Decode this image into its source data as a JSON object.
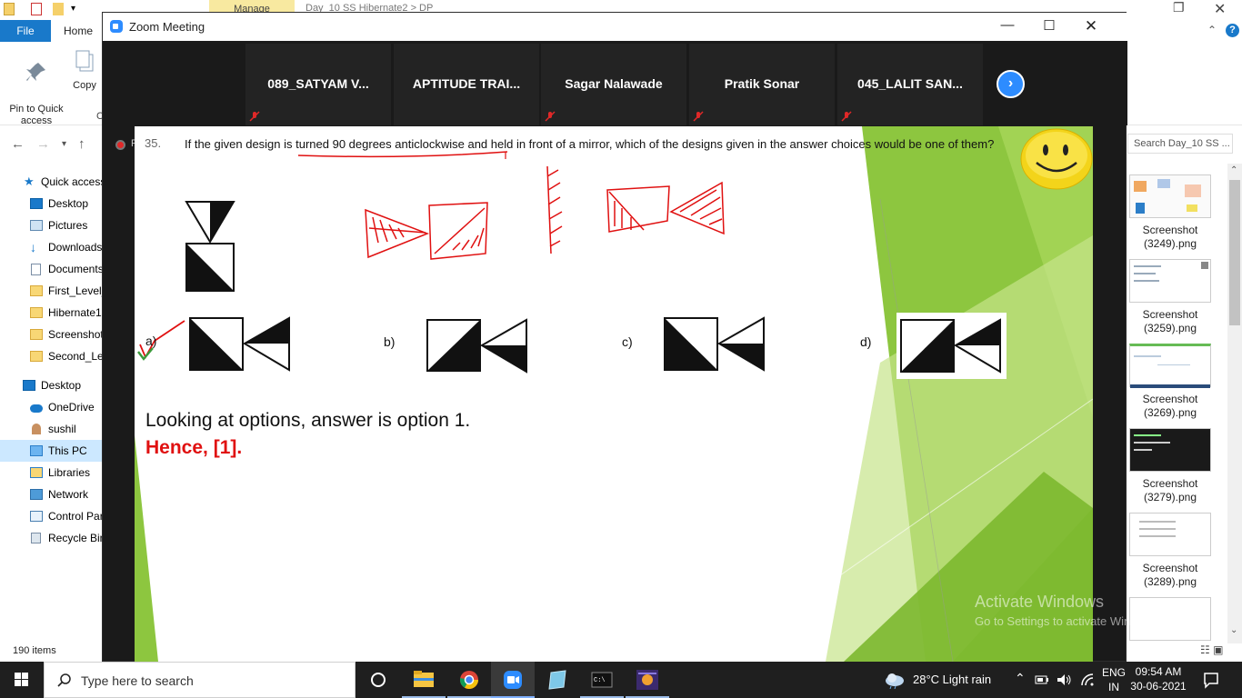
{
  "explorer": {
    "title_manage": "Manage",
    "title_path": "Day_10 SS Hibernate2 > DP",
    "tabs": {
      "file": "File",
      "home": "Home"
    },
    "ribbon": {
      "pin": "Pin to Quick\naccess",
      "copy": "Copy",
      "clipped": "C"
    },
    "search_placeholder": "Search Day_10 SS ...",
    "nav_items": [
      {
        "label": "Quick access",
        "icon": "star-icon"
      },
      {
        "label": "Desktop",
        "icon": "desktop-icon"
      },
      {
        "label": "Pictures",
        "icon": "pictures-icon"
      },
      {
        "label": "Downloads",
        "icon": "download-icon"
      },
      {
        "label": "Documents",
        "icon": "documents-icon"
      },
      {
        "label": "First_Level_",
        "icon": "folder-icon"
      },
      {
        "label": "Hibernate1",
        "icon": "folder-icon"
      },
      {
        "label": "Screenshot",
        "icon": "folder-icon"
      },
      {
        "label": "Second_Lev",
        "icon": "folder-icon"
      },
      {
        "label": "Desktop",
        "icon": "desktop-icon"
      },
      {
        "label": "OneDrive",
        "icon": "cloud-icon"
      },
      {
        "label": "sushil",
        "icon": "user-icon"
      },
      {
        "label": "This PC",
        "icon": "pc-icon"
      },
      {
        "label": "Libraries",
        "icon": "libraries-icon"
      },
      {
        "label": "Network",
        "icon": "network-icon"
      },
      {
        "label": "Control Par",
        "icon": "control-panel-icon"
      },
      {
        "label": "Recycle Bin",
        "icon": "recycle-bin-icon"
      }
    ],
    "status": "190 items",
    "thumbnails": [
      {
        "name": "Screenshot\n(3249).png"
      },
      {
        "name": "Screenshot\n(3259).png"
      },
      {
        "name": "Screenshot\n(3269).png"
      },
      {
        "name": "Screenshot\n(3279).png"
      },
      {
        "name": "Screenshot\n(3289).png"
      }
    ],
    "watermark_title": "Activate Windows",
    "watermark_sub": "Go to Settings to activate Windows."
  },
  "zoom": {
    "title": "Zoom Meeting",
    "participants": [
      {
        "name": "089_SATYAM V...",
        "muted": true
      },
      {
        "name": "APTITUDE TRAI...",
        "muted": false
      },
      {
        "name": "Sagar Nalawade",
        "muted": true
      },
      {
        "name": "Pratik Sonar",
        "muted": true
      },
      {
        "name": "045_LALIT SAN...",
        "muted": true
      }
    ],
    "recording_label": "R"
  },
  "slide": {
    "question_number": "35.",
    "question_text": "If the given design is turned 90 degrees anticlockwise and held in front of a mirror, which of the  designs given in the answer choices would be one of them?",
    "options": [
      "a)",
      "b)",
      "c)",
      "d)"
    ],
    "conclusion": "Looking at options, answer is option 1.",
    "answer": "Hence, [1]."
  },
  "taskbar": {
    "search_placeholder": "Type here to search",
    "weather": "28°C  Light rain",
    "language": "ENG\nIN",
    "time": "09:54 AM",
    "date": "30-06-2021"
  },
  "colors": {
    "zoom_blue": "#2d8cff",
    "annotation_red": "#e01010",
    "slide_green": "#8dc63f",
    "explorer_blue": "#1979ca"
  }
}
